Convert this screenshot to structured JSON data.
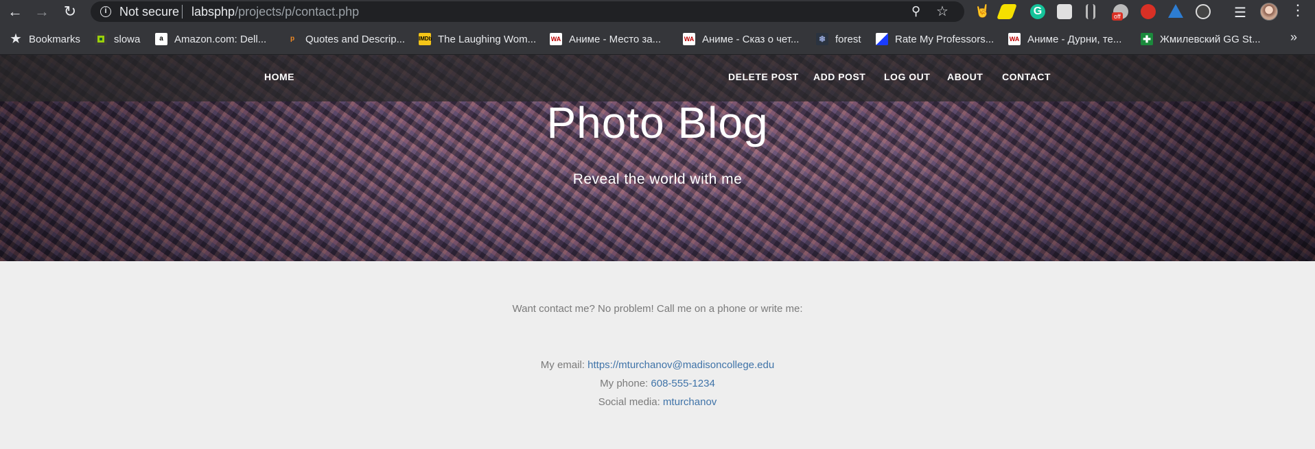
{
  "browser": {
    "security_label": "Not secure",
    "url_host": "labsphp",
    "url_path": "/projects/p/contact.php",
    "extension_badge": "off",
    "bookmarks": [
      {
        "label": "Bookmarks",
        "icon": "star-icon"
      },
      {
        "label": "slowa",
        "icon": "slowa-icon"
      },
      {
        "label": "Amazon.com: Dell...",
        "icon": "amazon-icon"
      },
      {
        "label": "Quotes and Descrip...",
        "icon": "quotes-icon"
      },
      {
        "label": "The Laughing Wom...",
        "icon": "imdb-icon"
      },
      {
        "label": "Аниме - Место за...",
        "icon": "wa-icon"
      },
      {
        "label": "Аниме - Сказ о чет...",
        "icon": "wa-icon"
      },
      {
        "label": "forest",
        "icon": "forest-icon"
      },
      {
        "label": "Rate My Professors...",
        "icon": "rmp-icon"
      },
      {
        "label": "Аниме - Дурни, те...",
        "icon": "wa-icon"
      },
      {
        "label": "Жмилевский GG St...",
        "icon": "cross-icon"
      }
    ]
  },
  "nav": {
    "home": "HOME",
    "delete_post": "DELETE POST",
    "add_post": "ADD POST",
    "log_out": "LOG OUT",
    "about": "ABOUT",
    "contact": "CONTACT"
  },
  "header": {
    "title": "Photo Blog",
    "subtitle": "Reveal the world with me"
  },
  "contact": {
    "intro": "Want contact me? No problem! Call me on a phone or write me:",
    "email_label": "My email:",
    "email_value": "https://mturchanov@madisoncollege.edu",
    "phone_label": "My phone:",
    "phone_value": "608-555-1234",
    "social_label": "Social media:",
    "social_value": "mturchanov"
  },
  "colors": {
    "link": "#3f73a8",
    "body_text": "#7a7a7a",
    "page_bg": "#eeeeee",
    "chrome_bg": "#35363a"
  }
}
